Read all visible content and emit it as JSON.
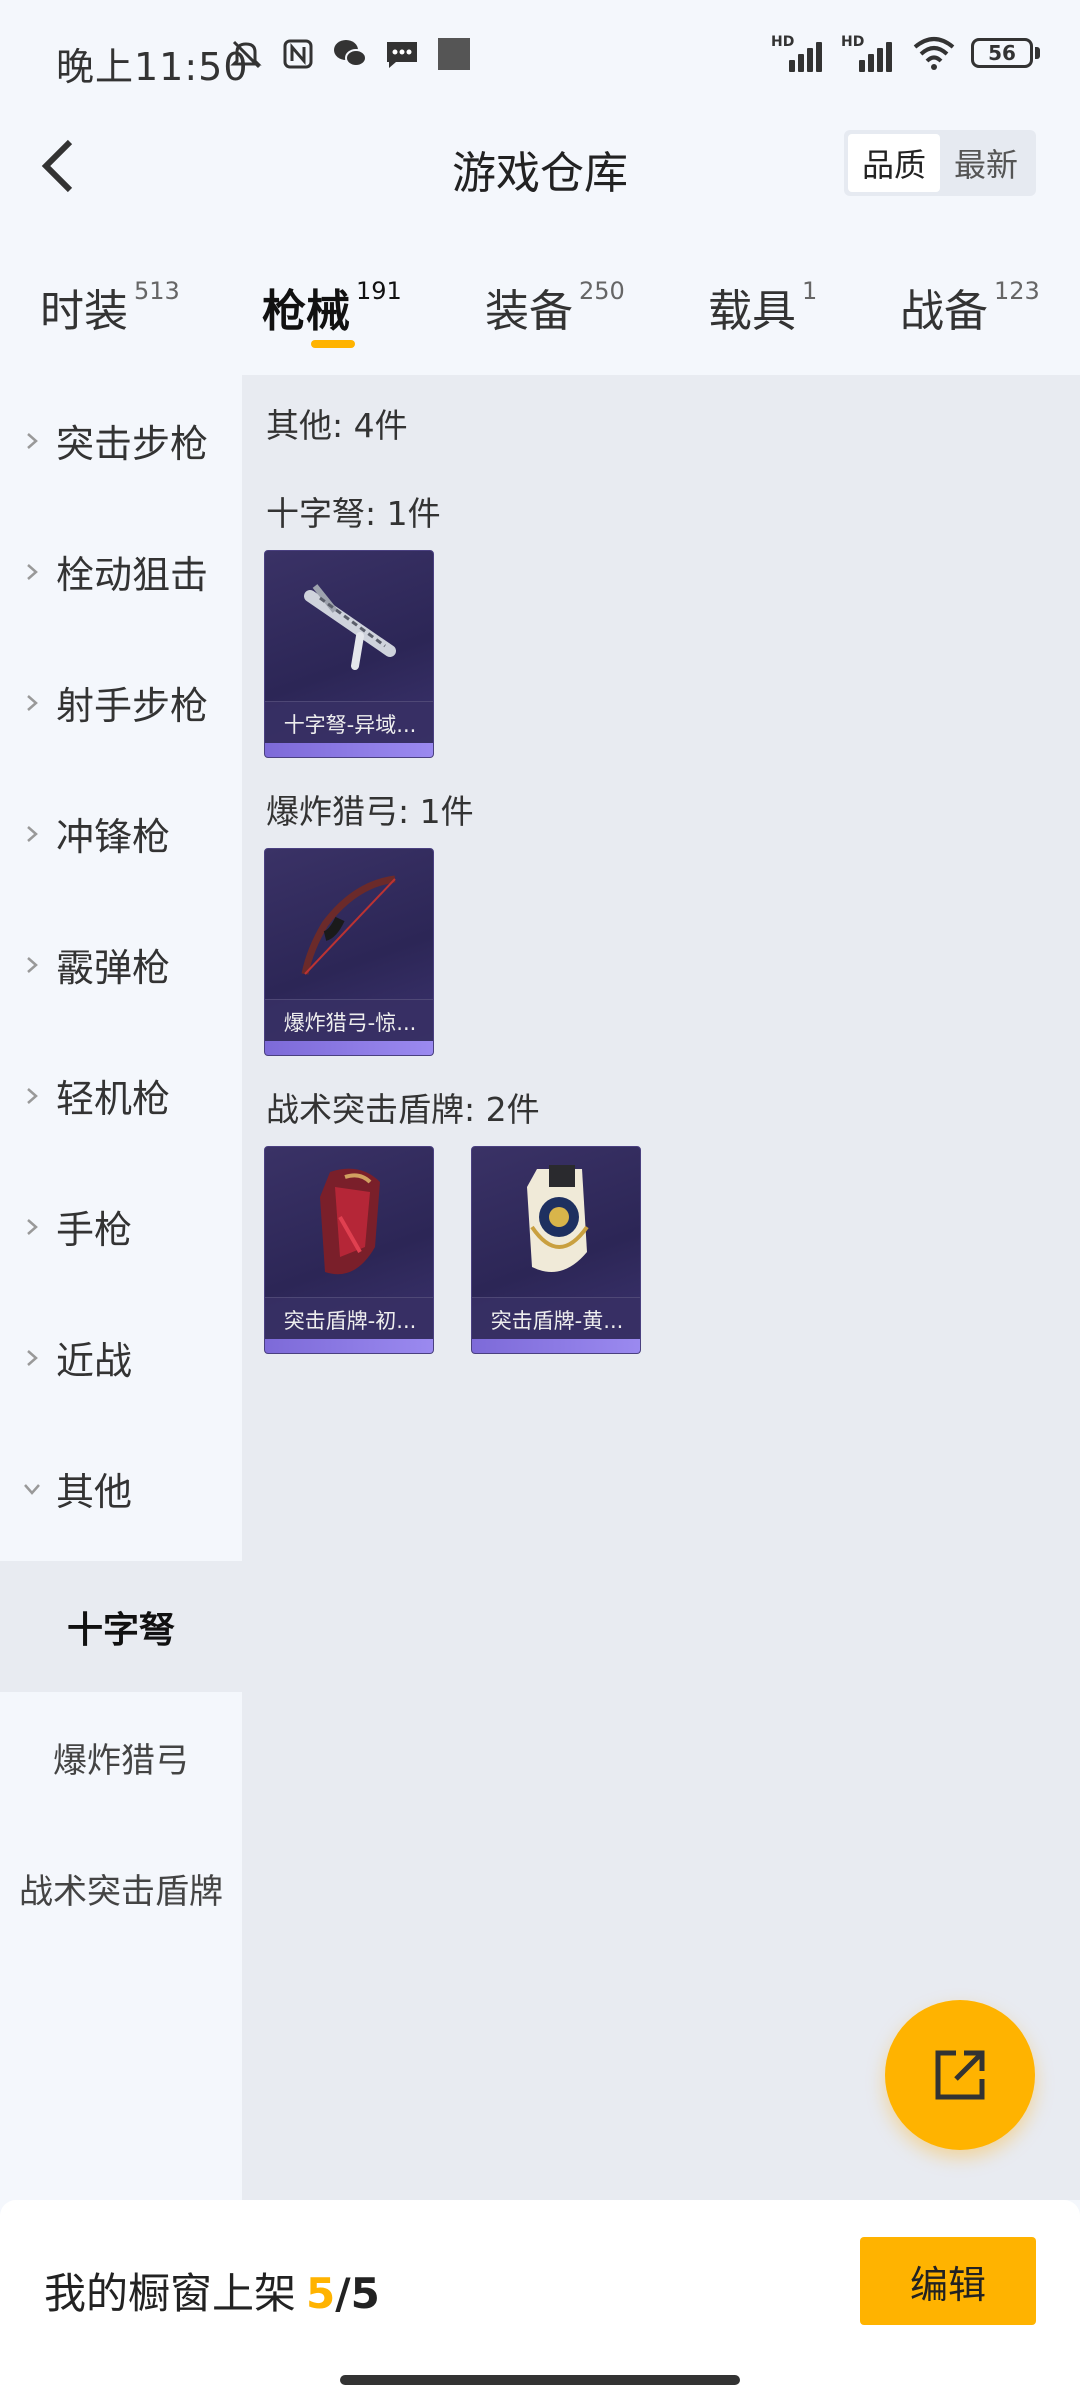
{
  "status_bar": {
    "time": "晚上11:50",
    "battery": "56"
  },
  "header": {
    "title": "游戏仓库",
    "sort_options": [
      "品质",
      "最新"
    ],
    "active_sort": "品质"
  },
  "tabs": [
    {
      "label": "时装",
      "count": "513"
    },
    {
      "label": "枪械",
      "count": "191"
    },
    {
      "label": "装备",
      "count": "250"
    },
    {
      "label": "载具",
      "count": "1"
    },
    {
      "label": "战备",
      "count": "123"
    }
  ],
  "sidebar": {
    "categories": [
      "突击步枪",
      "栓动狙击",
      "射手步枪",
      "冲锋枪",
      "霰弹枪",
      "轻机枪",
      "手枪",
      "近战",
      "其他"
    ],
    "subcategories": [
      "十字弩",
      "爆炸猎弓",
      "战术突击盾牌"
    ]
  },
  "content": {
    "summary": "其他: 4件",
    "sections": [
      {
        "label": "十字弩: 1件",
        "items": [
          "十字弩-异域..."
        ]
      },
      {
        "label": "爆炸猎弓: 1件",
        "items": [
          "爆炸猎弓-惊..."
        ]
      },
      {
        "label": "战术突击盾牌: 2件",
        "items": [
          "突击盾牌-初...",
          "突击盾牌-黄..."
        ]
      }
    ]
  },
  "bottom": {
    "showcase_label": "我的橱窗上架",
    "showcase_current": "5",
    "showcase_sep": "/",
    "showcase_total": "5",
    "edit_label": "编辑"
  },
  "colors": {
    "accent": "#ffb300",
    "panel": "#e8ebf1",
    "card": "#2c2656",
    "rarity": "#8a78e6"
  }
}
